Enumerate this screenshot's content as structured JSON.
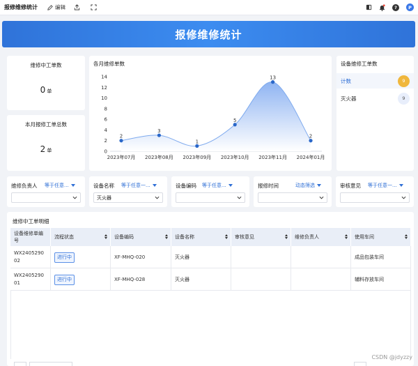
{
  "topbar": {
    "title": "报修维修统计",
    "edit_label": "编辑",
    "avatar_letter": "P"
  },
  "banner": {
    "title": "报修维修统计"
  },
  "stats": {
    "in_progress": {
      "label": "维修中工单数",
      "value": "0",
      "unit": "单"
    },
    "month_total": {
      "label": "本月报修工单总数",
      "value": "2",
      "unit": "单"
    }
  },
  "chart": {
    "title": "各月维修单数"
  },
  "chart_data": {
    "type": "area",
    "title": "各月维修单数",
    "categories": [
      "2023年07月",
      "2023年08月",
      "2023年09月",
      "2023年10月",
      "2023年11月",
      "2024年01月"
    ],
    "series": [
      {
        "values": [
          2,
          3,
          1,
          5,
          13,
          2
        ]
      }
    ],
    "yticks": [
      "14",
      "12",
      "10",
      "8",
      "6",
      "4",
      "2",
      "0"
    ],
    "ylim": [
      0,
      14
    ],
    "data_labels": [
      "2",
      "3",
      "1",
      "5",
      "13",
      "2"
    ],
    "grid": false,
    "colors": {
      "line": "#7eaaee",
      "fill_top": "#8fb4f2",
      "fill_bottom": "#ffffff",
      "point": "#2a67c9"
    }
  },
  "device": {
    "title": "设备维修工单数",
    "rows": [
      {
        "label": "计数",
        "count": "9",
        "badge_bg": "#f0b73d",
        "badge_color": "#ffffff",
        "label_color": "#2f6fd6"
      },
      {
        "label": "灭火器",
        "count": "9",
        "badge_bg": "#e8eefb",
        "badge_color": "#555555",
        "label_color": "#222222"
      }
    ]
  },
  "filters": [
    {
      "label": "维修负责人",
      "op": "等于任意...",
      "value": ""
    },
    {
      "label": "设备名称",
      "op": "等于任意一...",
      "value": "灭火器"
    },
    {
      "label": "设备编码",
      "op": "等于任意...",
      "value": ""
    },
    {
      "label": "报修时间",
      "op": "动态筛选",
      "value": ""
    },
    {
      "label": "审核意见",
      "op": "等于任意一...",
      "value": ""
    }
  ],
  "table": {
    "title": "维修中工单明细",
    "columns": [
      "设备维修单编号",
      "流程状态",
      "设备编码",
      "设备名称",
      "审核意见",
      "维修负责人",
      "使用车间"
    ],
    "rows": [
      [
        "WX240529002",
        "进行中",
        "XF-MHQ-020",
        "灭火器",
        "",
        "",
        "成品包装车间"
      ],
      [
        "WX240529001",
        "进行中",
        "XF-MHQ-028",
        "灭火器",
        "",
        "",
        "辅料存放车间"
      ]
    ]
  },
  "watermark": "CSDN @jdyzzy"
}
